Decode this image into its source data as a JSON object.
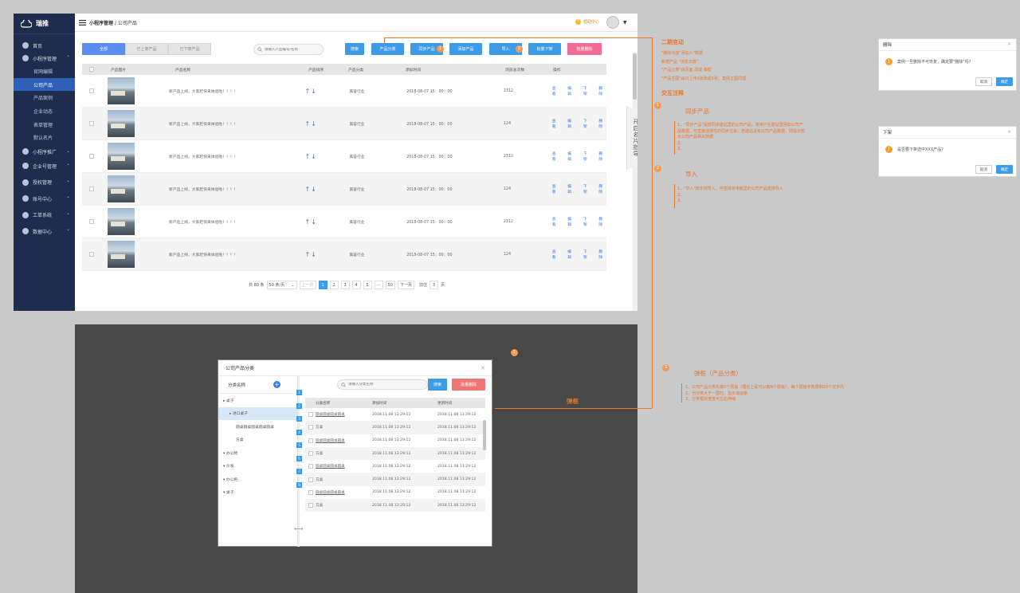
{
  "sidebar": {
    "logo": "瑞推",
    "items": [
      {
        "label": "首页",
        "type": "top"
      },
      {
        "label": "小程序管理",
        "type": "group",
        "open": true
      },
      {
        "label": "官网编辑",
        "type": "sub"
      },
      {
        "label": "公司产品",
        "type": "sub",
        "active": true
      },
      {
        "label": "产品案例",
        "type": "sub"
      },
      {
        "label": "企业动态",
        "type": "sub"
      },
      {
        "label": "表单管理",
        "type": "sub"
      },
      {
        "label": "默认名片",
        "type": "sub"
      },
      {
        "label": "小程序推广",
        "type": "group"
      },
      {
        "label": "企业号管理",
        "type": "group"
      },
      {
        "label": "授权管理",
        "type": "group"
      },
      {
        "label": "账号中心",
        "type": "group"
      },
      {
        "label": "工单系统",
        "type": "group"
      },
      {
        "label": "数据中心",
        "type": "group"
      }
    ]
  },
  "topbar": {
    "crumb_main": "小程序管理",
    "crumb_sep": " / ",
    "crumb_sub": "公司产品",
    "help": "帮助中心"
  },
  "tabs": [
    "全部",
    "已上架产品",
    "已下架产品"
  ],
  "search": {
    "placeholder": "请输入产品编号/名称",
    "button": "搜索"
  },
  "buttons": {
    "category": "产品分类",
    "sync": "同步产品",
    "add": "添加产品",
    "import": "导入",
    "bulk_off": "批量下架",
    "bulk_delete": "批量删除"
  },
  "table": {
    "headers": [
      "产品图片",
      "产品名称",
      "产品排序",
      "产品分类",
      "添加时间",
      "浏览总次数",
      "操作"
    ],
    "rows": [
      {
        "name": "新产品上线，大家赶快来体验啦！！！！",
        "category": "美容行业",
        "time": "2018-08-07  15：00：00",
        "views": "2312"
      },
      {
        "name": "新产品上线，大家赶快来体验啦！！！！",
        "category": "美容行业",
        "time": "2018-08-07  15：00：00",
        "views": "124"
      },
      {
        "name": "新产品上线，大家赶快来体验啦！！！！",
        "category": "美容行业",
        "time": "2018-08-07  15：00：00",
        "views": "2312"
      },
      {
        "name": "新产品上线，大家赶快来体验啦！！！！",
        "category": "美容行业",
        "time": "2018-08-07  15：00：00",
        "views": "124"
      },
      {
        "name": "新产品上线，大家赶快来体验啦！！！！",
        "category": "美容行业",
        "time": "2018-08-07  15：00：00",
        "views": "2312"
      },
      {
        "name": "新产品上线，大家赶快来体验啦！！！！",
        "category": "美容行业",
        "time": "2018-08-07  15：00：00",
        "views": "124"
      }
    ],
    "ops": [
      "查看",
      "编辑",
      "下架",
      "删除"
    ]
  },
  "pager": {
    "total": "共 80 条",
    "per_page": "50 条/页",
    "prev": "上一页",
    "pages": [
      "1",
      "2",
      "3",
      "4",
      "5",
      "···",
      "50"
    ],
    "current": "1",
    "next": "下一页",
    "goto_label": "前往",
    "goto_value": "3",
    "page_suffix": "页"
  },
  "guide": "开启名片指导",
  "dialog": {
    "title": "公司产品分类",
    "tree_header": "分类名称",
    "tree": [
      {
        "label": "▸ 桌子",
        "indent": 1
      },
      {
        "label": "▸ 进口桌子",
        "indent": 2,
        "selected": true
      },
      {
        "label": "圆桌圆桌圆桌圆桌圆桌",
        "indent": 3
      },
      {
        "label": "方桌",
        "indent": 3
      },
      {
        "label": "▾ 办公椅",
        "indent": 1
      },
      {
        "label": "▾ 沙发",
        "indent": 1
      },
      {
        "label": "▾ 办公柜",
        "indent": 1
      },
      {
        "label": "▾ 桌子",
        "indent": 1
      }
    ],
    "search_placeholder": "请输入分类名称",
    "search_button": "搜索",
    "bulk_delete": "批量删除",
    "headers": [
      "分类名称",
      "添加时间",
      "更新时间"
    ],
    "rows": [
      {
        "name": "圆桌圆桌圆桌圆桌",
        "added": "2018.11.08  13:29:12",
        "updated": "2018.11.08  13:29:12",
        "link": true
      },
      {
        "name": "方桌",
        "added": "2018.11.08  13:29:12",
        "updated": "2018.11.08  13:29:12"
      },
      {
        "name": "圆桌圆桌圆桌圆桌",
        "added": "2018.11.08  13:29:12",
        "updated": "2018.11.08  13:29:12",
        "link": true
      },
      {
        "name": "方桌",
        "added": "2018.11.08  13:29:12",
        "updated": "2018.11.08  13:29:12"
      },
      {
        "name": "圆桌圆桌圆桌圆桌",
        "added": "2018.11.08  13:29:12",
        "updated": "2018.11.08  13:29:12",
        "link": true
      },
      {
        "name": "方桌",
        "added": "2018.11.08  13:29:12",
        "updated": "2018.11.08  13:29:12"
      },
      {
        "name": "圆桌圆桌圆桌圆桌",
        "added": "2018.11.08  13:29:12",
        "updated": "2018.11.08  13:29:12",
        "link": true
      },
      {
        "name": "方桌",
        "added": "2018.11.08  13:29:12",
        "updated": "2018.11.08  13:29:12"
      }
    ],
    "num_tags": [
      "1",
      "2",
      "3",
      "4",
      "5",
      "6",
      "7",
      "8"
    ]
  },
  "annotations": {
    "phase2_title": "二期变动",
    "phase2_lines": [
      "\"删除功能\"添加人\"数据",
      "新增产品 \"浏览次数\"",
      "\"产品分类\"由页面 改成 弹框",
      "\"产品主图\"由只上传1张改成5张，案例主图同理"
    ],
    "interaction_title": "交互注释",
    "sync_title": "同步产品",
    "sync_lines": [
      "1、\"同步产品\"是按同步建站里的公司产品，将用户在建站里添加公司产",
      "   品数据，可直接选择性的同步过来；若建站没有公司产品数据，则提示暂",
      "   无公司产品相关数据",
      "2、",
      "3、"
    ],
    "import_title": "导入",
    "import_lines": [
      "1、\"导入\"按本地导入，可直接将电脑里的公司产品直接导入",
      "2、",
      "3、"
    ],
    "popup_title": "弹框（产品分类）",
    "popup_lines": [
      "1、公司产品分类先做5个层级（理论上是可以做N个层级），每个层级字数限制20个汉字内",
      "2、当分类大于一屏时，显示滚动条",
      "3、分类框的宽度可左右伸缩"
    ],
    "popup_label": "弹框",
    "dot_labels": [
      "1",
      "2",
      "3",
      "1",
      "2"
    ]
  },
  "popup_delete": {
    "title": "删除",
    "message": "案例一旦删除不可恢复，确定要\"删除\"吗?",
    "cancel": "取消",
    "ok": "确定"
  },
  "popup_offshelf": {
    "title": "下架",
    "message": "是否要下架选中XXX产品?",
    "cancel": "取消",
    "ok": "确定"
  },
  "colors": {
    "sidebar": "#1e2c4e",
    "primary": "#3d9be8",
    "danger": "#f26b94",
    "annotation": "#e8762b"
  }
}
